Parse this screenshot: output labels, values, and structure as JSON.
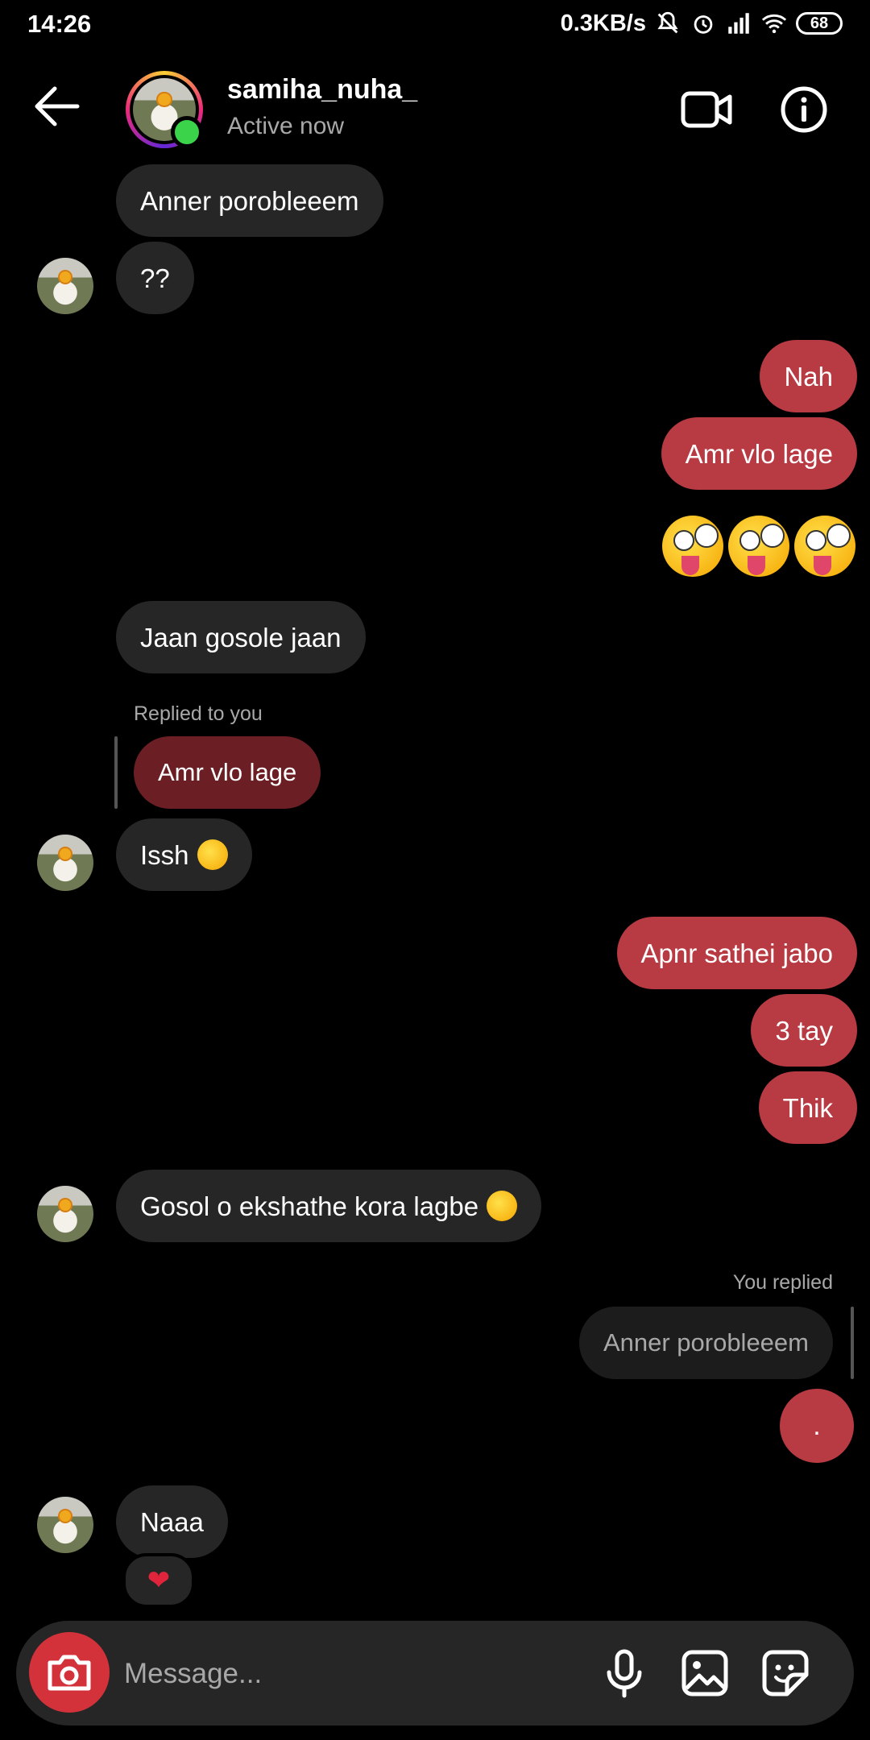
{
  "status": {
    "time": "14:26",
    "network_speed": "0.3KB/s",
    "battery": "68"
  },
  "header": {
    "username": "samiha_nuha_",
    "status": "Active now"
  },
  "messages": {
    "m1": "Anner porobleeem",
    "m2": "??",
    "m3": "Nah",
    "m4": "Amr vlo lage",
    "m5": "Jaan gosole jaan",
    "replied_label": "Replied to you",
    "m6_quote": "Amr vlo lage",
    "m7": "Issh",
    "m8": "Apnr sathei jabo",
    "m9": "3 tay",
    "m10": "Thik",
    "m11": "Gosol o ekshathe kora lagbe",
    "you_replied_label": "You replied",
    "m12_quote": "Anner porobleeem",
    "m13": ".",
    "m14": "Naaa",
    "reaction": "❤"
  },
  "composer": {
    "placeholder": "Message..."
  },
  "colors": {
    "outgoing": "#b83a42",
    "incoming": "#262626",
    "background": "#000000"
  }
}
